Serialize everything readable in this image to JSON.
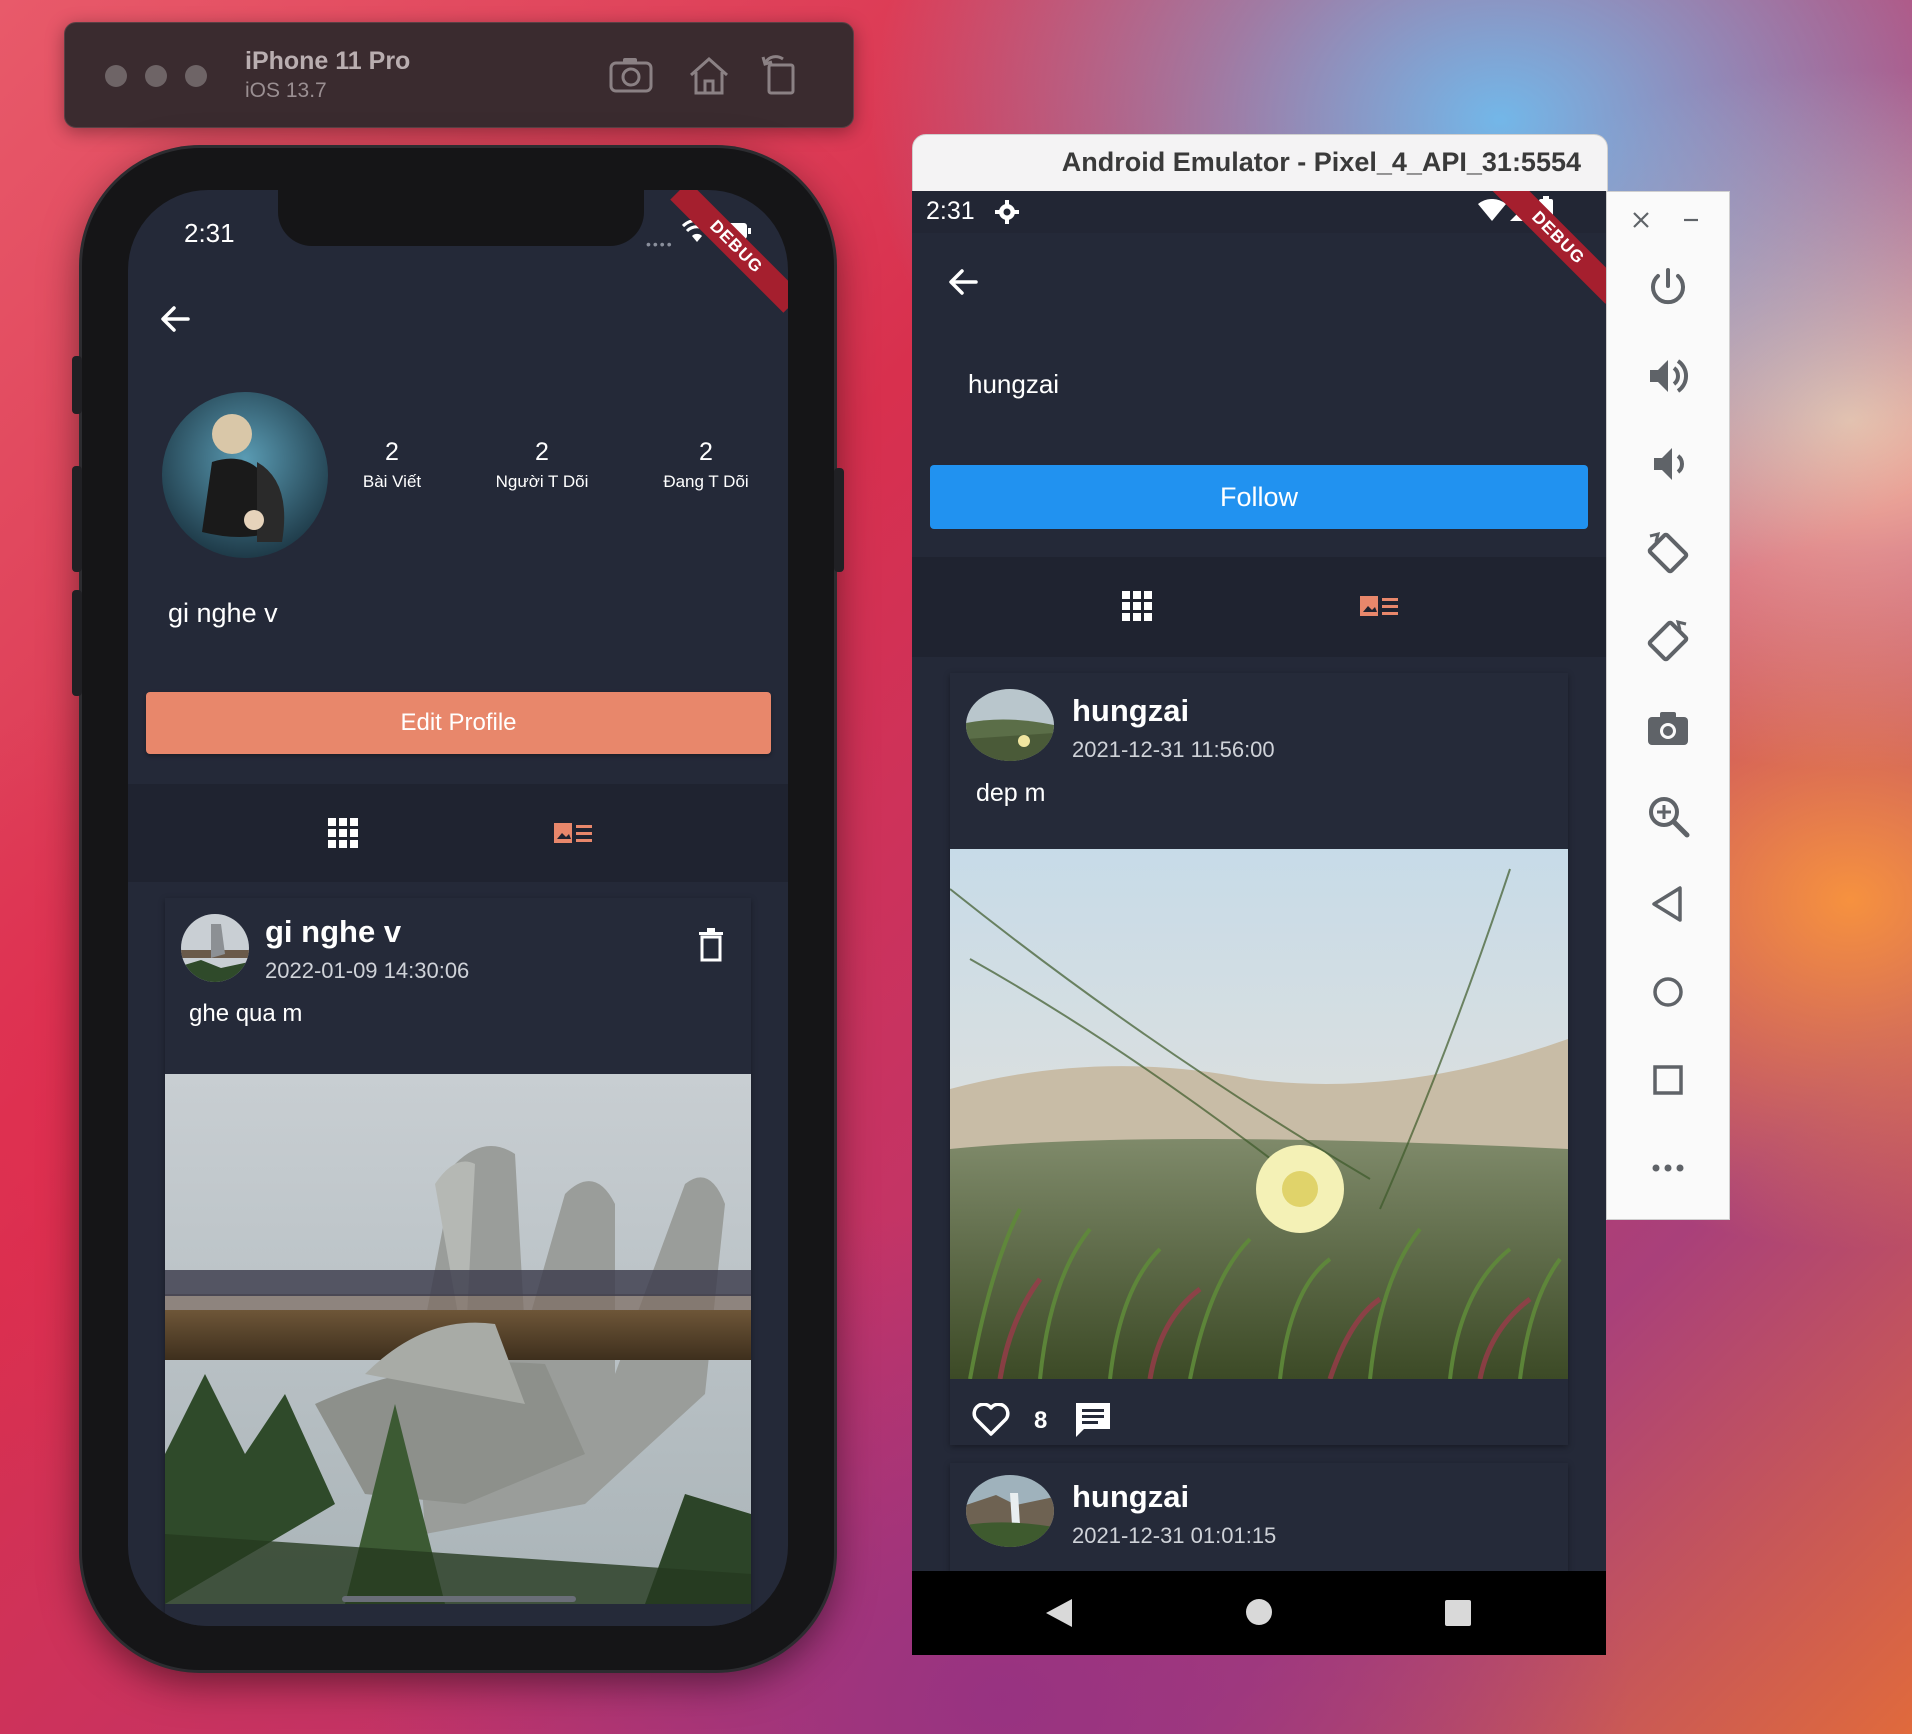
{
  "ios_simulator": {
    "device_name": "iPhone 11 Pro",
    "os_version": "iOS 13.7",
    "toolbar_icons": [
      "screenshot-icon",
      "home-icon",
      "rotate-icon"
    ]
  },
  "ios_app": {
    "status_time": "2:31",
    "debug_label": "DEBUG",
    "profile": {
      "display_name": "gi nghe v",
      "stats": [
        {
          "value": "2",
          "label": "Bài Viết"
        },
        {
          "value": "2",
          "label": "Người T Dõi"
        },
        {
          "value": "2",
          "label": "Đang T Dõi"
        }
      ],
      "edit_button": "Edit Profile"
    },
    "post": {
      "author": "gi nghe v",
      "timestamp": "2022-01-09 14:30:06",
      "caption": "ghe qua m"
    }
  },
  "android_emulator": {
    "window_title": "Android Emulator - Pixel_4_API_31:5554",
    "status_time": "2:31",
    "debug_label": "DEBUG",
    "profile": {
      "display_name": "hungzai",
      "follow_button": "Follow"
    },
    "posts": [
      {
        "author": "hungzai",
        "timestamp": "2021-12-31 11:56:00",
        "caption": "dep m",
        "likes": "8"
      },
      {
        "author": "hungzai",
        "timestamp": "2021-12-31 01:01:15"
      }
    ],
    "side_panel_icons": [
      "close-icon",
      "minimize-icon",
      "power-icon",
      "volume-up-icon",
      "volume-down-icon",
      "rotate-left-icon",
      "rotate-right-icon",
      "camera-icon",
      "zoom-icon",
      "back-icon",
      "home-icon",
      "overview-icon",
      "more-icon"
    ]
  },
  "colors": {
    "app_background": "#242938",
    "edit_button": "#e8876b",
    "follow_button": "#2192f0",
    "tab_active_accent": "#e8876b",
    "debug_ribbon": "#a51f2e"
  }
}
